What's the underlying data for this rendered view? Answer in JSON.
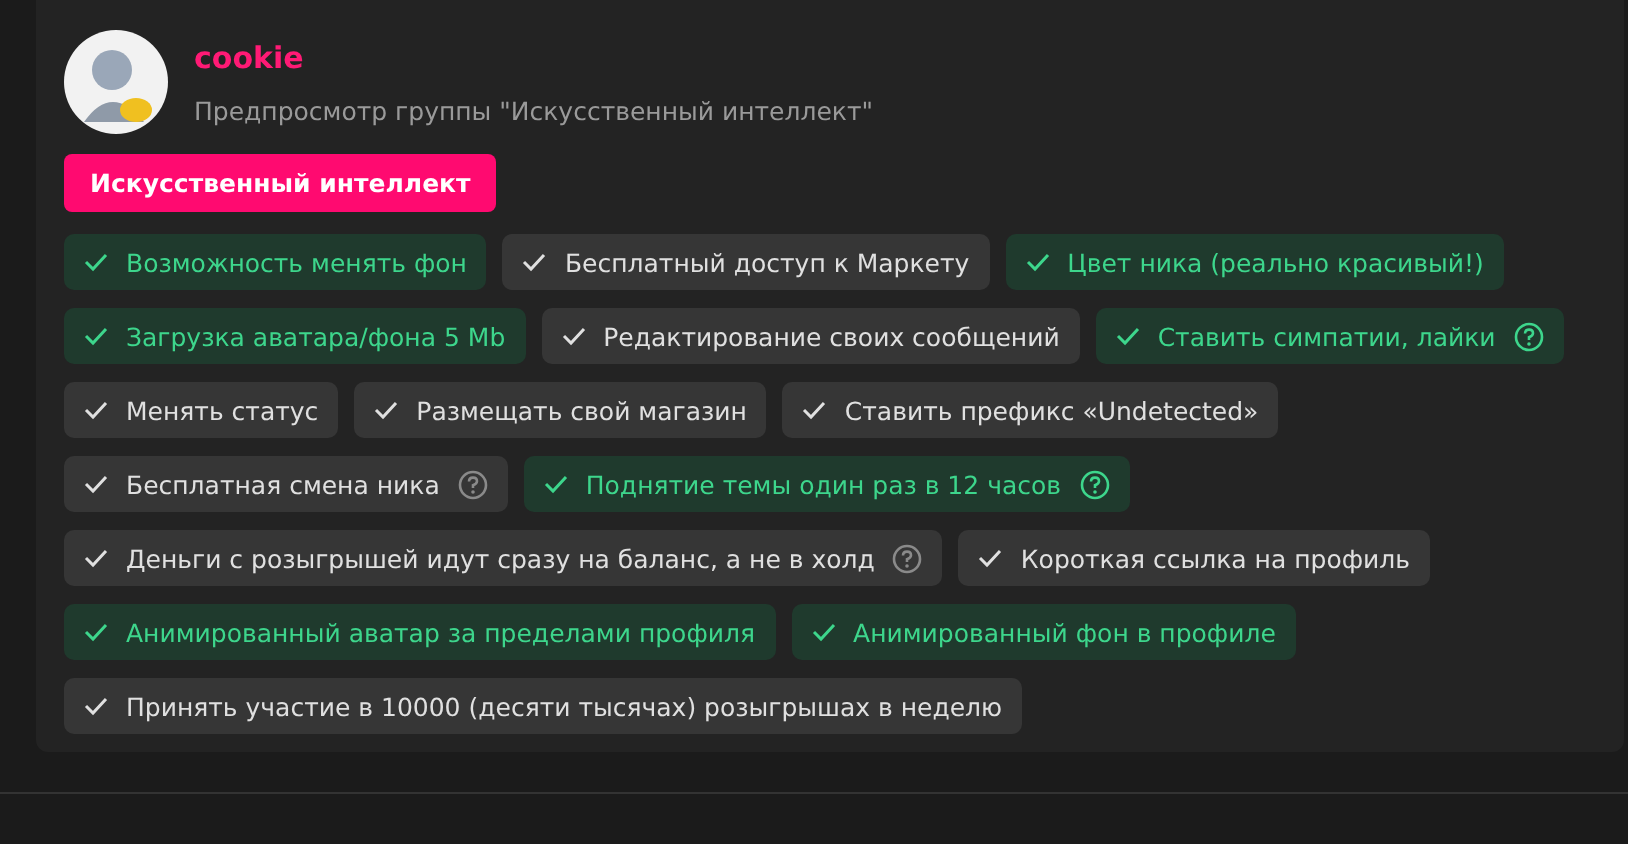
{
  "user": {
    "name": "cookie",
    "subtitle": "Предпросмотр группы \"Искусственный интеллект\""
  },
  "group_badge": "Искусственный интеллект",
  "perk_rows": [
    [
      {
        "label": "Возможность менять фон",
        "highlighted": true,
        "help": false
      },
      {
        "label": "Бесплатный доступ к Маркету",
        "highlighted": false,
        "help": false
      },
      {
        "label": "Цвет ника (реально красивый!)",
        "highlighted": true,
        "help": false
      }
    ],
    [
      {
        "label": "Загрузка аватара/фона 5 Mb",
        "highlighted": true,
        "help": false
      },
      {
        "label": "Редактирование своих сообщений",
        "highlighted": false,
        "help": false
      },
      {
        "label": "Ставить симпатии, лайки",
        "highlighted": true,
        "help": true
      }
    ],
    [
      {
        "label": "Менять статус",
        "highlighted": false,
        "help": false
      },
      {
        "label": "Размещать свой магазин",
        "highlighted": false,
        "help": false
      },
      {
        "label": "Ставить префикс «Undetected»",
        "highlighted": false,
        "help": false
      }
    ],
    [
      {
        "label": "Бесплатная смена ника",
        "highlighted": false,
        "help": true
      },
      {
        "label": "Поднятие темы один раз в 12 часов",
        "highlighted": true,
        "help": true
      }
    ],
    [
      {
        "label": "Деньги с розыгрышей идут сразу на баланс, а не в холд",
        "highlighted": false,
        "help": true
      },
      {
        "label": "Короткая ссылка на профиль",
        "highlighted": false,
        "help": false
      }
    ],
    [
      {
        "label": "Анимированный аватар за пределами профиля",
        "highlighted": true,
        "help": false
      },
      {
        "label": "Анимированный фон в профиле",
        "highlighted": true,
        "help": false
      }
    ],
    [
      {
        "label": "Принять участие в 10000 (десяти тысячах) розыгрышах в неделю",
        "highlighted": false,
        "help": false
      }
    ]
  ]
}
